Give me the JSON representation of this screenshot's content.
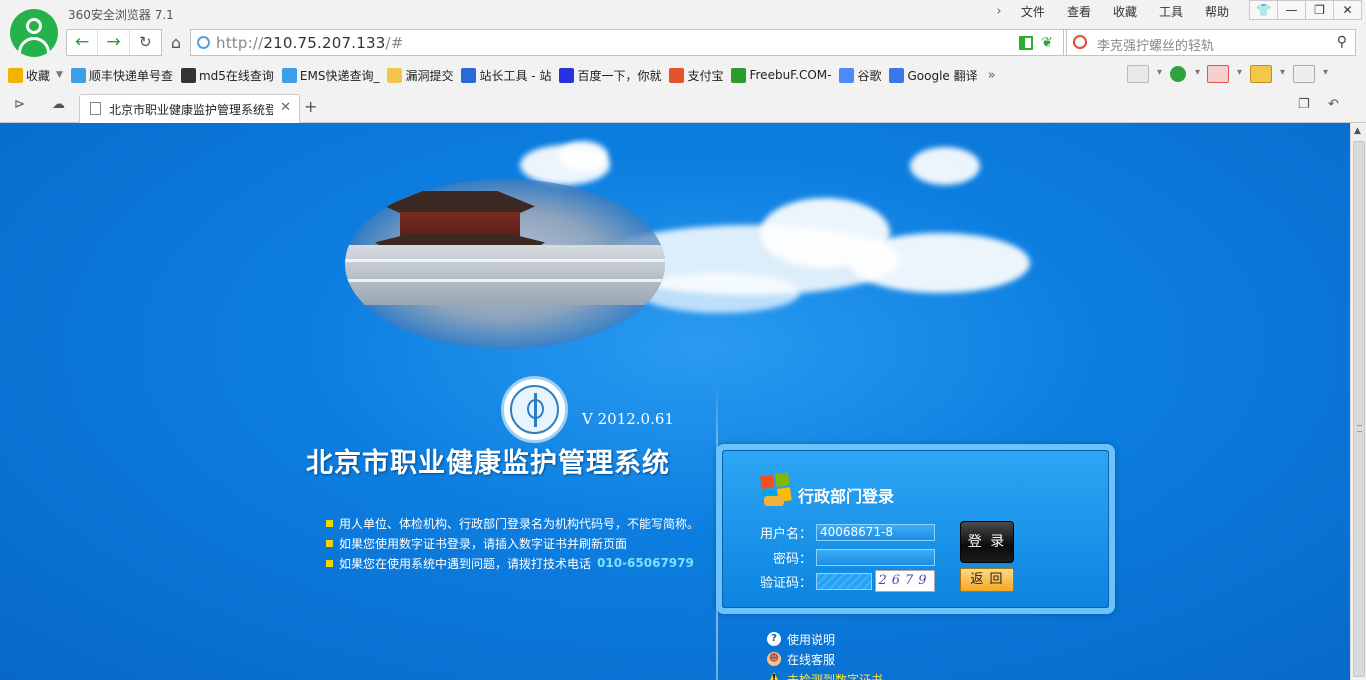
{
  "browser": {
    "title": "360安全浏览器 7.1",
    "menu": [
      "文件",
      "查看",
      "收藏",
      "工具",
      "帮助"
    ],
    "url_scheme": "http://",
    "url_host": "210.75.207.133",
    "url_rest": "/#",
    "search_placeholder": "李克强拧螺丝的轻轨",
    "bookmarks": [
      {
        "label": "收藏",
        "icon": "star-icon",
        "color": "#f0b400"
      },
      {
        "label": "顺丰快递单号查",
        "icon": "ie-icon",
        "color": "#3b9ee8"
      },
      {
        "label": "md5在线查询",
        "icon": "grid-icon",
        "color": "#333333"
      },
      {
        "label": "EMS快递查询_",
        "icon": "ie-icon",
        "color": "#3b9ee8"
      },
      {
        "label": "漏洞提交",
        "icon": "folder-icon",
        "color": "#f3c64a"
      },
      {
        "label": "站长工具 - 站",
        "icon": "chart-icon",
        "color": "#2a6ad8"
      },
      {
        "label": "百度一下，你就",
        "icon": "paw-icon",
        "color": "#2932e1"
      },
      {
        "label": "支付宝",
        "icon": "shield-icon",
        "color": "#e2532d"
      },
      {
        "label": "FreebuF.COM-",
        "icon": "f-icon",
        "color": "#2c9b2c"
      },
      {
        "label": "谷歌",
        "icon": "g-icon",
        "color": "#4c8bf5"
      },
      {
        "label": "Google 翻译",
        "icon": "translate-icon",
        "color": "#3b78e7"
      }
    ],
    "tab_label": "北京市职业健康监护管理系统登"
  },
  "page": {
    "version": "V 2012.0.61",
    "system_title": "北京市职业健康监护管理系统",
    "tips": [
      "用人单位、体检机构、行政部门登录名为机构代码号，不能写简称。",
      "如果您使用数字证书登录，请插入数字证书并刷新页面",
      "如果您在使用系统中遇到问题，请拨打技术电话"
    ],
    "phone": "010-65067979",
    "login": {
      "title": "行政部门登录",
      "username_label": "用户名：",
      "username_value": "40068671-8",
      "password_label": "密码：",
      "captcha_label": "验证码：",
      "captcha_text": "2679",
      "login_button": "登 录",
      "back_button": "返 回"
    },
    "help": {
      "usage": "使用说明",
      "service": "在线客服",
      "cert_warning": "未检测到数字证书"
    }
  },
  "colors": {
    "page_blue": "#0c7ee0",
    "accent_yellow": "#f4d20c",
    "phone_cyan": "#7ee1ff",
    "avatar_green": "#25b24a"
  }
}
